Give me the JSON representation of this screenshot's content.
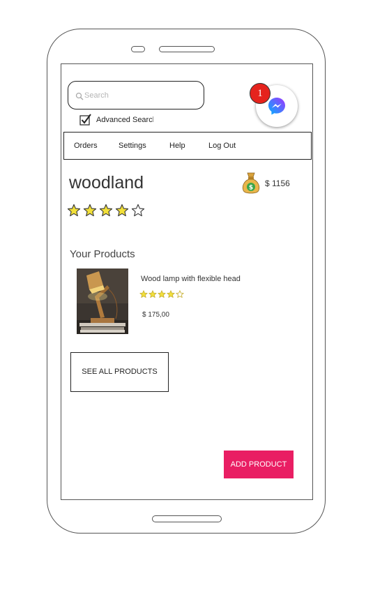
{
  "search": {
    "placeholder": "Search",
    "value": ""
  },
  "advanced_search": {
    "label": "Advanced Search",
    "checked": true
  },
  "messenger": {
    "badge_count": "1",
    "icon": "messenger-icon"
  },
  "nav": {
    "items": [
      {
        "label": "Orders"
      },
      {
        "label": "Settings"
      },
      {
        "label": "Help"
      },
      {
        "label": "Log Out"
      }
    ]
  },
  "store": {
    "name": "woodland",
    "rating": 4,
    "rating_max": 5
  },
  "balance": {
    "amount": "$ 1156",
    "icon": "money-bag-icon"
  },
  "products": {
    "title": "Your Products",
    "items": [
      {
        "name": "Wood lamp with flexible head",
        "price": "$ 175,00",
        "rating": 4,
        "rating_max": 5
      }
    ],
    "see_all_label": "SEE ALL PRODUCTS"
  },
  "actions": {
    "add_product_label": "ADD PRODUCT"
  },
  "colors": {
    "accent": "#e91e63",
    "badge": "#e5231d",
    "star_fill": "#f2e03a",
    "messenger_start": "#00b2ff",
    "messenger_end": "#a033ff"
  }
}
